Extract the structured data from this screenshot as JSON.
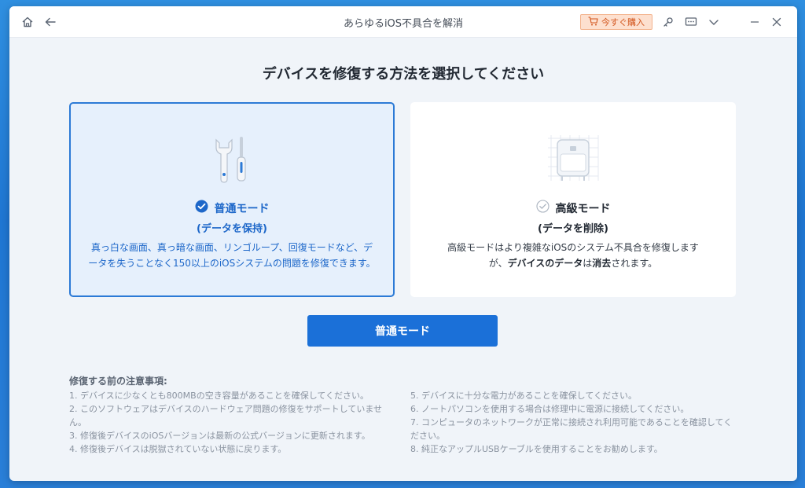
{
  "titlebar": {
    "title": "あらゆるiOS不具合を解消",
    "buy_label": "今すぐ購入",
    "icons": [
      "home-icon",
      "back-arrow-icon",
      "cart-icon",
      "key-icon",
      "feedback-icon",
      "chevron-down-icon",
      "minimize-icon",
      "close-icon"
    ]
  },
  "main": {
    "heading": "デバイスを修復する方法を選択してください",
    "standard": {
      "title": "普通モード",
      "subtitle": "(データを保持)",
      "description": "真っ白な画面、真っ暗な画面、リンゴループ、回復モードなど、データを失うことなく150以上のiOSシステムの問題を修復できます。",
      "icon": "tools-icon",
      "selected": true
    },
    "advanced": {
      "title": "高級モード",
      "subtitle": "(データを削除)",
      "desc_part1": "高級モードはより複雑なiOSのシステム不具合を修復します",
      "desc_part2": "が、",
      "desc_bold1": "デバイスのデータ",
      "desc_part3": "は",
      "desc_bold2": "消去",
      "desc_part4": "されます。",
      "icon": "device-reset-icon",
      "selected": false
    },
    "action_button": "普通モード"
  },
  "notes": {
    "title": "修復する前の注意事項:",
    "left": [
      "1.  デバイスに少なくとも800MBの空き容量があることを確保してください。",
      "2.  このソフトウェアはデバイスのハードウェア問題の修復をサポートしていません。",
      "3.  修復後デバイスのiOSバージョンは最新の公式バージョンに更新されます。",
      "4.  修復後デバイスは脱獄されていない状態に戻ります。"
    ],
    "right": [
      "5.  デバイスに十分な電力があることを確保してください。",
      "6.  ノートパソコンを使用する場合は修理中に電源に接続してください。",
      "7.  コンピュータのネットワークが正常に接続され利用可能であることを確認してください。",
      "8.  純正なアップルUSBケーブルを使用することをお勧めします。"
    ]
  },
  "colors": {
    "accent": "#1b70d8",
    "selected_card_bg": "#e6f0fc",
    "buy_bg": "#fde0cf",
    "window_bg": "#f0f4f9"
  }
}
